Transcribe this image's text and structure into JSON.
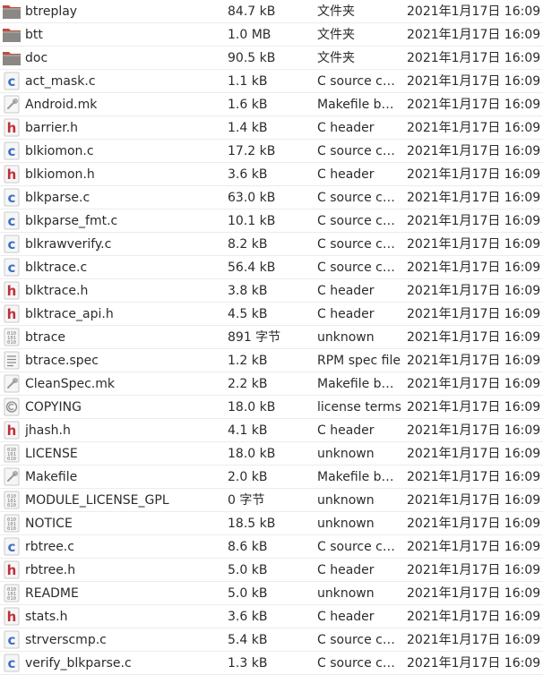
{
  "files": [
    {
      "name": "btreplay",
      "size": "84.7 kB",
      "type": "文件夹",
      "modified": "2021年1月17日 16:09",
      "icon": "folder-icon"
    },
    {
      "name": "btt",
      "size": "1.0 MB",
      "type": "文件夹",
      "modified": "2021年1月17日 16:09",
      "icon": "folder-icon"
    },
    {
      "name": "doc",
      "size": "90.5 kB",
      "type": "文件夹",
      "modified": "2021年1月17日 16:09",
      "icon": "folder-icon"
    },
    {
      "name": "act_mask.c",
      "size": "1.1 kB",
      "type": "C source co…",
      "modified": "2021年1月17日 16:09",
      "icon": "c-source-icon"
    },
    {
      "name": "Android.mk",
      "size": "1.6 kB",
      "type": "Makefile bu…",
      "modified": "2021年1月17日 16:09",
      "icon": "makefile-icon"
    },
    {
      "name": "barrier.h",
      "size": "1.4 kB",
      "type": "C header",
      "modified": "2021年1月17日 16:09",
      "icon": "c-header-icon"
    },
    {
      "name": "blkiomon.c",
      "size": "17.2 kB",
      "type": "C source co…",
      "modified": "2021年1月17日 16:09",
      "icon": "c-source-icon"
    },
    {
      "name": "blkiomon.h",
      "size": "3.6 kB",
      "type": "C header",
      "modified": "2021年1月17日 16:09",
      "icon": "c-header-icon"
    },
    {
      "name": "blkparse.c",
      "size": "63.0 kB",
      "type": "C source co…",
      "modified": "2021年1月17日 16:09",
      "icon": "c-source-icon"
    },
    {
      "name": "blkparse_fmt.c",
      "size": "10.1 kB",
      "type": "C source co…",
      "modified": "2021年1月17日 16:09",
      "icon": "c-source-icon"
    },
    {
      "name": "blkrawverify.c",
      "size": "8.2 kB",
      "type": "C source co…",
      "modified": "2021年1月17日 16:09",
      "icon": "c-source-icon"
    },
    {
      "name": "blktrace.c",
      "size": "56.4 kB",
      "type": "C source co…",
      "modified": "2021年1月17日 16:09",
      "icon": "c-source-icon"
    },
    {
      "name": "blktrace.h",
      "size": "3.8 kB",
      "type": "C header",
      "modified": "2021年1月17日 16:09",
      "icon": "c-header-icon"
    },
    {
      "name": "blktrace_api.h",
      "size": "4.5 kB",
      "type": "C header",
      "modified": "2021年1月17日 16:09",
      "icon": "c-header-icon"
    },
    {
      "name": "btrace",
      "size": "891 字节",
      "type": "unknown",
      "modified": "2021年1月17日 16:09",
      "icon": "binary-file-icon"
    },
    {
      "name": "btrace.spec",
      "size": "1.2 kB",
      "type": "RPM spec file",
      "modified": "2021年1月17日 16:09",
      "icon": "text-file-icon"
    },
    {
      "name": "CleanSpec.mk",
      "size": "2.2 kB",
      "type": "Makefile bu…",
      "modified": "2021年1月17日 16:09",
      "icon": "makefile-icon"
    },
    {
      "name": "COPYING",
      "size": "18.0 kB",
      "type": "license terms",
      "modified": "2021年1月17日 16:09",
      "icon": "license-icon"
    },
    {
      "name": "jhash.h",
      "size": "4.1 kB",
      "type": "C header",
      "modified": "2021年1月17日 16:09",
      "icon": "c-header-icon"
    },
    {
      "name": "LICENSE",
      "size": "18.0 kB",
      "type": "unknown",
      "modified": "2021年1月17日 16:09",
      "icon": "binary-file-icon"
    },
    {
      "name": "Makefile",
      "size": "2.0 kB",
      "type": "Makefile bu…",
      "modified": "2021年1月17日 16:09",
      "icon": "makefile-icon"
    },
    {
      "name": "MODULE_LICENSE_GPL",
      "size": "0 字节",
      "type": "unknown",
      "modified": "2021年1月17日 16:09",
      "icon": "binary-file-icon"
    },
    {
      "name": "NOTICE",
      "size": "18.5 kB",
      "type": "unknown",
      "modified": "2021年1月17日 16:09",
      "icon": "binary-file-icon"
    },
    {
      "name": "rbtree.c",
      "size": "8.6 kB",
      "type": "C source co…",
      "modified": "2021年1月17日 16:09",
      "icon": "c-source-icon"
    },
    {
      "name": "rbtree.h",
      "size": "5.0 kB",
      "type": "C header",
      "modified": "2021年1月17日 16:09",
      "icon": "c-header-icon"
    },
    {
      "name": "README",
      "size": "5.0 kB",
      "type": "unknown",
      "modified": "2021年1月17日 16:09",
      "icon": "binary-file-icon"
    },
    {
      "name": "stats.h",
      "size": "3.6 kB",
      "type": "C header",
      "modified": "2021年1月17日 16:09",
      "icon": "c-header-icon"
    },
    {
      "name": "strverscmp.c",
      "size": "5.4 kB",
      "type": "C source co…",
      "modified": "2021年1月17日 16:09",
      "icon": "c-source-icon"
    },
    {
      "name": "verify_blkparse.c",
      "size": "1.3 kB",
      "type": "C source co…",
      "modified": "2021年1月17日 16:09",
      "icon": "c-source-icon"
    }
  ],
  "colors": {
    "folder": "#8a8784",
    "folder_tab": "#c04a3b",
    "c_source": "#3d6ec9",
    "c_header": "#c0303a",
    "text": "#2b2b2b"
  }
}
